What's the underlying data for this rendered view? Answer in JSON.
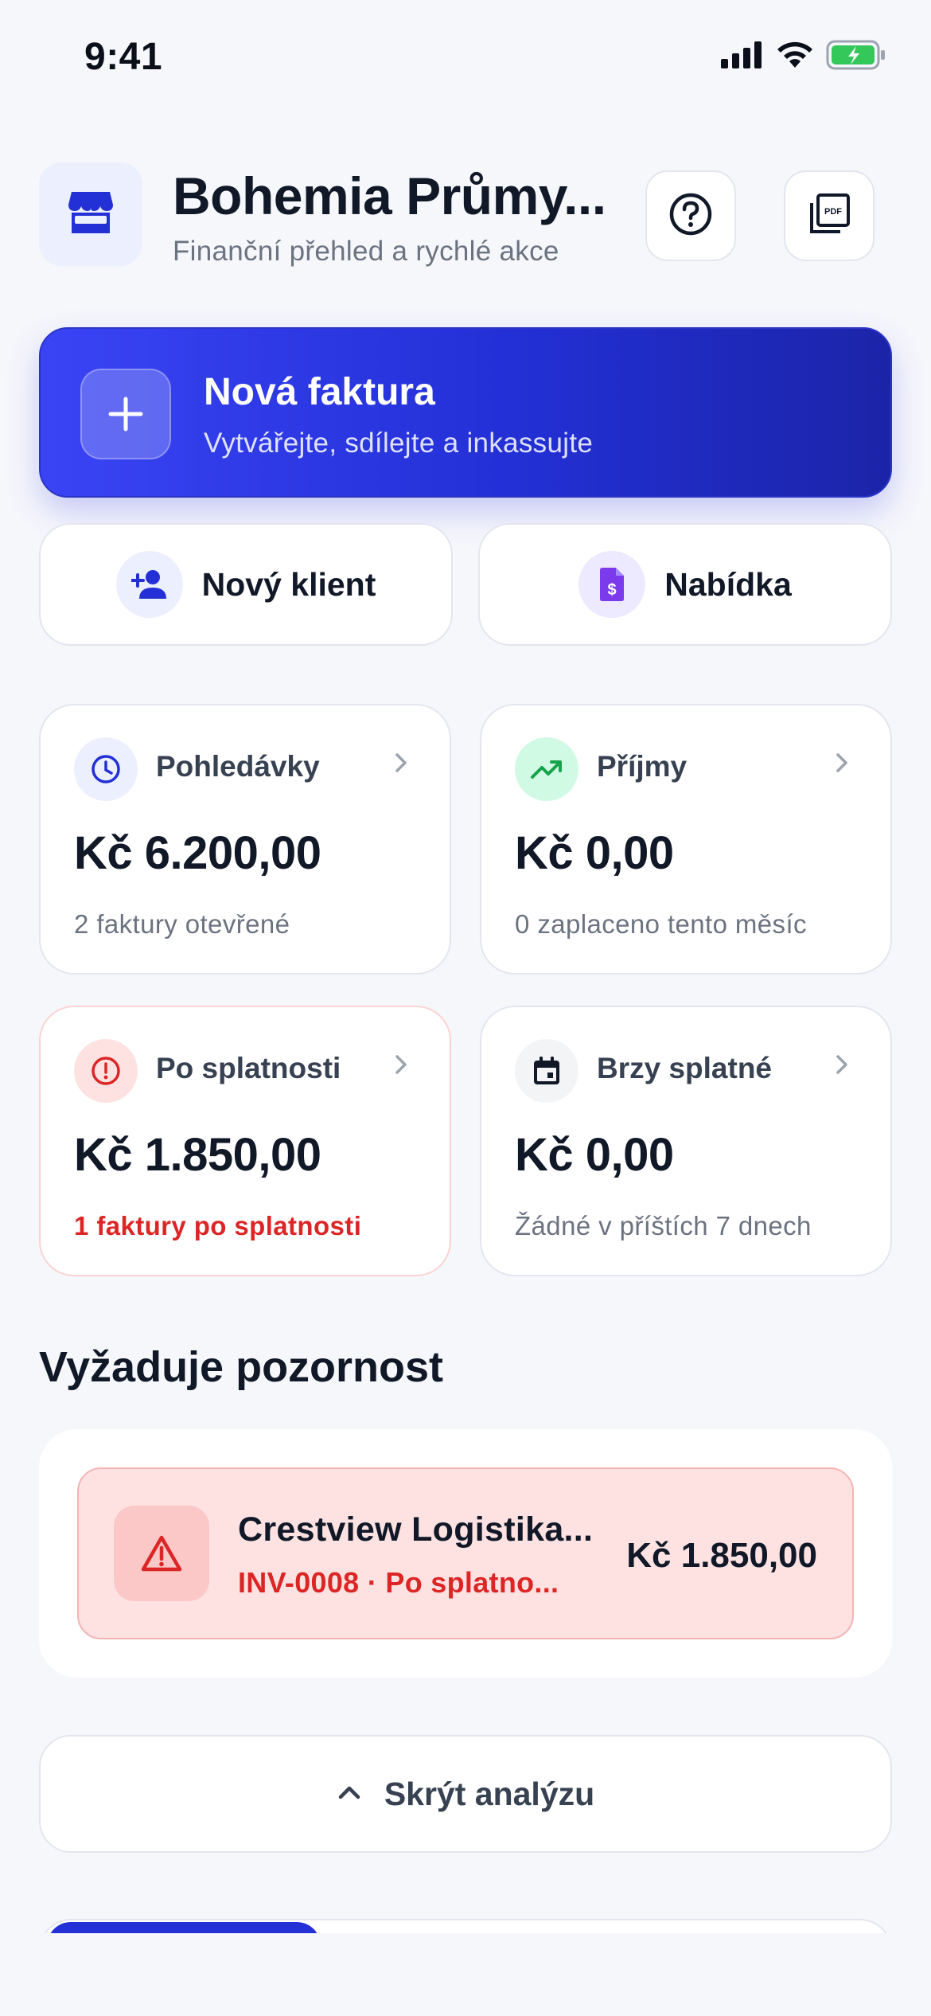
{
  "status_bar": {
    "time": "9:41"
  },
  "header": {
    "title": "Bohemia Průmy...",
    "subtitle": "Finanční přehled a rychlé akce"
  },
  "cta": {
    "title": "Nová faktura",
    "subtitle": "Vytvářejte, sdílejte a inkassujte"
  },
  "quick_actions": {
    "new_client": "Nový klient",
    "quote": "Nabídka"
  },
  "stats": [
    {
      "title": "Pohledávky",
      "value": "Kč 6.200,00",
      "note": "2 faktury otevřené"
    },
    {
      "title": "Příjmy",
      "value": "Kč 0,00",
      "note": "0 zaplaceno tento měsíc"
    },
    {
      "title": "Po splatnosti",
      "value": "Kč 1.850,00",
      "note": "1 faktury po splatnosti"
    },
    {
      "title": "Brzy splatné",
      "value": "Kč 0,00",
      "note": "Žádné v příštích 7 dnech"
    }
  ],
  "attention": {
    "title": "Vyžaduje pozornost",
    "items": [
      {
        "client": "Crestview Logistika...",
        "meta": "INV-0008 · Po splatno...",
        "amount": "Kč 1.850,00"
      }
    ]
  },
  "toggle": {
    "label": "Skrýt analýzu"
  },
  "colors": {
    "primary": "#2330d6",
    "danger": "#dc2626",
    "success": "#16a34a",
    "accent_purple": "#7c3aed",
    "background": "#f6f7fb"
  },
  "icons": {
    "store": "storefront-icon",
    "help": "help-circle-icon",
    "pdf": "pdf-icon",
    "plus": "plus-icon",
    "add_person": "person-add-icon",
    "quote": "document-dollar-icon",
    "clock": "clock-icon",
    "trend": "trending-up-icon",
    "alert": "alert-circle-icon",
    "calendar": "calendar-icon",
    "warning": "warning-triangle-icon",
    "chevron_up": "chevron-up-icon"
  }
}
